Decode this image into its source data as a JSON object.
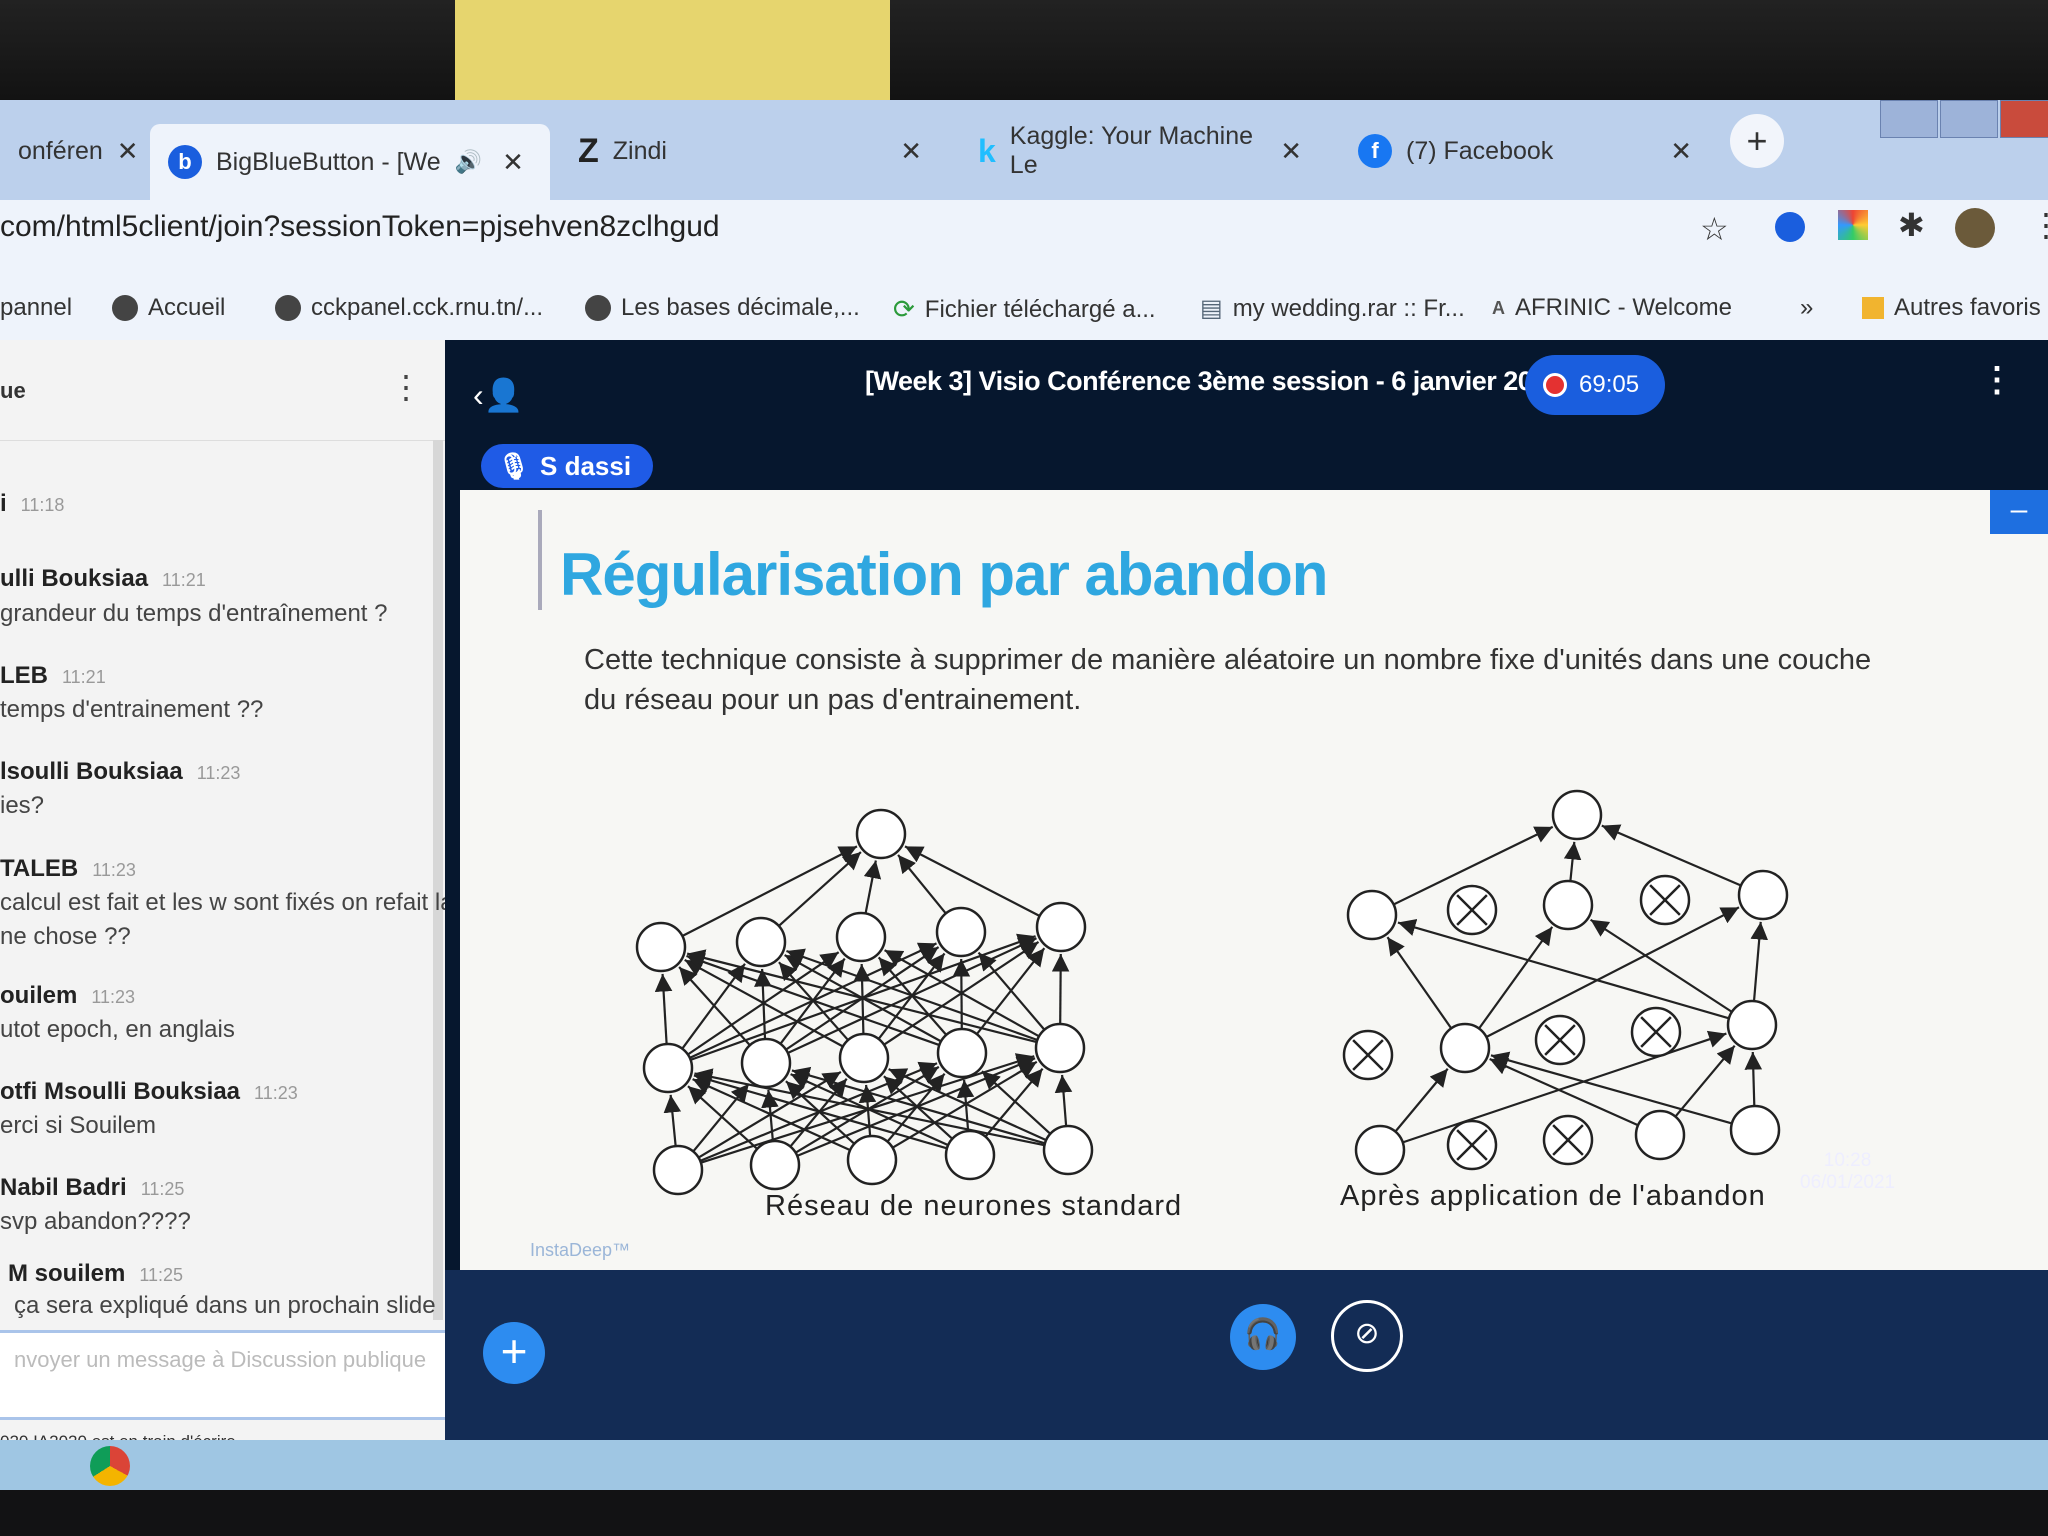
{
  "tabs": [
    {
      "label": "onféren",
      "icon": "doc-icon"
    },
    {
      "label": "BigBlueButton - [We",
      "icon": "bigbluebutton-icon"
    },
    {
      "label": "Zindi",
      "icon": "zindi-icon"
    },
    {
      "label": "Kaggle: Your Machine Le",
      "icon": "kaggle-icon"
    },
    {
      "label": "(7) Facebook",
      "icon": "facebook-icon"
    }
  ],
  "address": {
    "url": "com/html5client/join?sessionToken=pjsehven8zclhgud"
  },
  "bookmarks": [
    "pannel",
    "Accueil",
    "cckpanel.cck.rnu.tn/...",
    "Les bases décimale,...",
    "Fichier téléchargé a...",
    "my wedding.rar :: Fr...",
    "AFRINIC - Welcome",
    "»",
    "Autres favoris"
  ],
  "chat": {
    "header": "ue",
    "messages": [
      {
        "author": "i",
        "time": "11:18",
        "text": ""
      },
      {
        "author": "ulli Bouksiaa",
        "time": "11:21",
        "text": "grandeur du temps d'entraînement ?"
      },
      {
        "author": "LEB",
        "time": "11:21",
        "text": "temps d'entrainement ??"
      },
      {
        "author": "lsoulli Bouksiaa",
        "time": "11:23",
        "text": "ies?"
      },
      {
        "author": "TALEB",
        "time": "11:23",
        "text": "calcul est fait et les w sont fixés on refait la"
      },
      {
        "author": "",
        "time": "",
        "text": "ne chose ??"
      },
      {
        "author": "ouilem",
        "time": "11:23",
        "text": "utot epoch, en anglais"
      },
      {
        "author": "otfi Msoulli Bouksiaa",
        "time": "11:23",
        "text": "erci si Souilem"
      },
      {
        "author": "Nabil Badri",
        "time": "11:25",
        "text": "svp abandon????"
      },
      {
        "author": "M souilem",
        "time": "11:25",
        "text": "ça sera expliqué dans un prochain slide"
      }
    ],
    "input_placeholder": "nvoyer un message à Discussion publique",
    "typing": "020 IA2020 est en train d'écrire"
  },
  "session": {
    "title": "[Week 3] Visio Conférence 3ème session - 6 janvier 2021",
    "timer": "69:05",
    "talker": "S dassi"
  },
  "slide": {
    "title": "Régularisation par abandon",
    "body": "Cette technique consiste à supprimer de manière aléatoire un nombre fixe d'unités dans une couche du réseau pour un pas d'entrainement.",
    "caption_left": "Réseau de neurones standard",
    "caption_right": "Après application de l'abandon",
    "watermark": "InstaDeep™"
  },
  "clock": {
    "time": "10:28",
    "date": "06/01/2021"
  },
  "colors": {
    "accent": "#2d8cf0",
    "slide_title": "#2fa7e0",
    "header_bg": "#06172e"
  }
}
